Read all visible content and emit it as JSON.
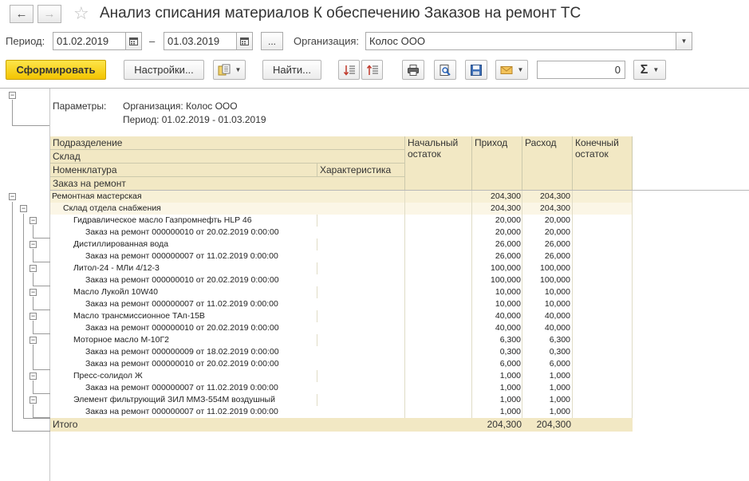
{
  "window": {
    "title": "Анализ списания материалов К обеспечению Заказов на ремонт ТС"
  },
  "form": {
    "period_label": "Период:",
    "date_from": "01.02.2019",
    "date_sep": "–",
    "date_to": "01.03.2019",
    "ellipsis": "...",
    "org_label": "Организация:",
    "org_value": "Колос ООО"
  },
  "toolbar": {
    "generate": "Сформировать",
    "settings": "Настройки...",
    "find": "Найти...",
    "sum_value": "0"
  },
  "report": {
    "params_label": "Параметры:",
    "params_org": "Организация: Колос ООО",
    "params_period": "Период: 01.02.2019 - 01.03.2019",
    "headers": {
      "subdivision": "Подразделение",
      "warehouse": "Склад",
      "nomenclature": "Номенклатура",
      "characteristic": "Характеристика",
      "order": "Заказ на ремонт",
      "opening": "Начальный остаток",
      "income": "Приход",
      "expense": "Расход",
      "closing": "Конечный остаток"
    },
    "rows": [
      {
        "level": 0,
        "text": "Ремонтная мастерская",
        "income": "204,300",
        "expense": "204,300"
      },
      {
        "level": 1,
        "text": "Склад отдела снабжения",
        "income": "204,300",
        "expense": "204,300"
      },
      {
        "level": 2,
        "text": "Гидравлическое масло Газпромнефть HLP 46",
        "income": "20,000",
        "expense": "20,000"
      },
      {
        "level": 3,
        "text": "Заказ на ремонт 000000010 от 20.02.2019 0:00:00",
        "income": "20,000",
        "expense": "20,000"
      },
      {
        "level": 2,
        "text": "Дистиллированная вода",
        "income": "26,000",
        "expense": "26,000"
      },
      {
        "level": 3,
        "text": "Заказ на ремонт 000000007 от 11.02.2019 0:00:00",
        "income": "26,000",
        "expense": "26,000"
      },
      {
        "level": 2,
        "text": "Литол-24 - МЛи 4/12-3",
        "income": "100,000",
        "expense": "100,000"
      },
      {
        "level": 3,
        "text": "Заказ на ремонт 000000010 от 20.02.2019 0:00:00",
        "income": "100,000",
        "expense": "100,000"
      },
      {
        "level": 2,
        "text": "Масло Лукойл 10W40",
        "income": "10,000",
        "expense": "10,000"
      },
      {
        "level": 3,
        "text": "Заказ на ремонт 000000007 от 11.02.2019 0:00:00",
        "income": "10,000",
        "expense": "10,000"
      },
      {
        "level": 2,
        "text": "Масло трансмиссионное ТАп-15В",
        "income": "40,000",
        "expense": "40,000"
      },
      {
        "level": 3,
        "text": "Заказ на ремонт 000000010 от 20.02.2019 0:00:00",
        "income": "40,000",
        "expense": "40,000"
      },
      {
        "level": 2,
        "text": "Моторное масло М-10Г2",
        "income": "6,300",
        "expense": "6,300"
      },
      {
        "level": 3,
        "text": "Заказ на ремонт 000000009 от 18.02.2019 0:00:00",
        "income": "0,300",
        "expense": "0,300"
      },
      {
        "level": 3,
        "text": "Заказ на ремонт 000000010 от 20.02.2019 0:00:00",
        "income": "6,000",
        "expense": "6,000"
      },
      {
        "level": 2,
        "text": "Пресс-солидол Ж",
        "income": "1,000",
        "expense": "1,000"
      },
      {
        "level": 3,
        "text": "Заказ на ремонт 000000007 от 11.02.2019 0:00:00",
        "income": "1,000",
        "expense": "1,000"
      },
      {
        "level": 2,
        "text": "Элемент фильтрующий ЗИЛ ММЗ-554М воздушный",
        "income": "1,000",
        "expense": "1,000"
      },
      {
        "level": 3,
        "text": "Заказ на ремонт 000000007 от 11.02.2019 0:00:00",
        "income": "1,000",
        "expense": "1,000"
      }
    ],
    "total": {
      "label": "Итого",
      "income": "204,300",
      "expense": "204,300"
    }
  }
}
